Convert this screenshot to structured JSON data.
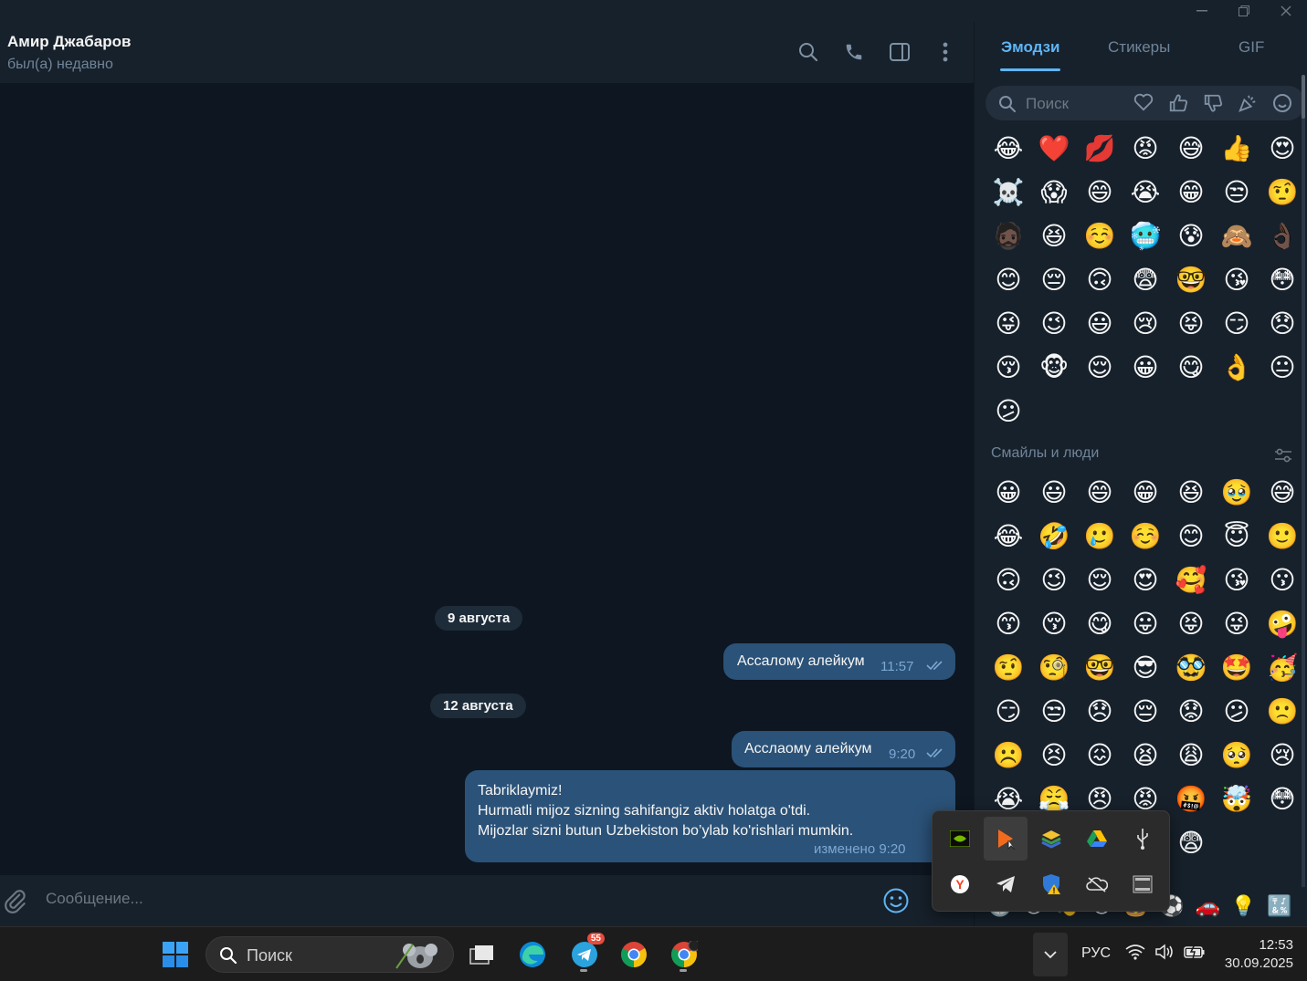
{
  "window": {
    "controls": [
      "minimize",
      "restore",
      "close"
    ]
  },
  "chat": {
    "contact_name": "Амир Джабаров",
    "contact_status": "был(а) недавно",
    "dates": [
      "9 августа",
      "12 августа"
    ],
    "messages": [
      {
        "text": "Ассалому алейкум",
        "time": "11:57"
      },
      {
        "text": "Асслаому алейкум",
        "time": "9:20"
      },
      {
        "lines": [
          "Tabriklaymiz!",
          "Hurmatli mijoz sizning sahifangiz aktiv holatga o'tdi.",
          "Mijozlar sizni butun Uzbekiston bo’ylab ko'rishlari mumkin."
        ],
        "edited_time": "изменено 9:20"
      }
    ],
    "composer_placeholder": "Сообщение..."
  },
  "emoji_panel": {
    "tabs": [
      "Эмодзи",
      "Стикеры",
      "GIF"
    ],
    "active_tab": "Эмодзи",
    "search_placeholder": "Поиск",
    "recent": [
      "😂",
      "❤️",
      "💋",
      "😡",
      "😅",
      "👍",
      "😍",
      "☠️",
      "😱",
      "😄",
      "😭",
      "😁",
      "😒",
      "🤨",
      "🧔🏿",
      "😆",
      "☺️",
      "🥶",
      "😰",
      "🙈",
      "👌🏿",
      "😊",
      "😔",
      "🙃",
      "😨",
      "🤓",
      "😘",
      "😳",
      "😜",
      "😉",
      "😃",
      "😢",
      "😝",
      "😏",
      "😞",
      "😚",
      "🐵",
      "😌",
      "😀",
      "😋",
      "👌",
      "😐",
      "😕"
    ],
    "section_title": "Смайлы и люди",
    "smileys": [
      "😀",
      "😃",
      "😄",
      "😁",
      "😆",
      "🥹",
      "😅",
      "😂",
      "🤣",
      "🥲",
      "☺️",
      "😊",
      "😇",
      "🙂",
      "🙃",
      "😉",
      "😌",
      "😍",
      "🥰",
      "😘",
      "😗",
      "😙",
      "😚",
      "😋",
      "😛",
      "😝",
      "😜",
      "🤪",
      "🤨",
      "🧐",
      "🤓",
      "😎",
      "🥸",
      "🤩",
      "🥳",
      "😏",
      "😒",
      "😞",
      "😔",
      "😟",
      "😕",
      "🙁",
      "☹️",
      "😣",
      "😖",
      "😫",
      "😩",
      "🥺",
      "😢",
      "😭",
      "😤",
      "😠",
      "😡",
      "🤬",
      "🤯",
      "😳",
      "🥵",
      "🥶",
      "😶‍🌫️",
      "😱",
      "😨"
    ]
  },
  "tray": {
    "icons": [
      "nvidia-icon",
      "cursor-app-icon",
      "layers-app-icon",
      "google-drive-icon",
      "usb-icon",
      "yandex-icon",
      "telegram-icon",
      "defender-warning-icon",
      "onedrive-off-icon",
      "film-app-icon"
    ]
  },
  "taskbar": {
    "search_placeholder": "Поиск",
    "telegram_badge": "55",
    "language": "РУС",
    "time": "12:53",
    "date": "30.09.2025"
  }
}
